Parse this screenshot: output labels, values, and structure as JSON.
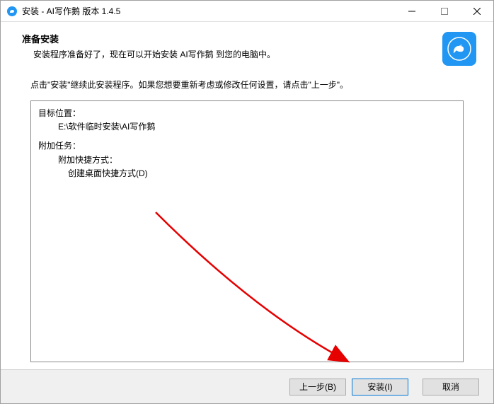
{
  "titlebar": {
    "title": "安装 - AI写作鹅 版本 1.4.5"
  },
  "header": {
    "title": "准备安装",
    "subtitle": "安装程序准备好了，现在可以开始安装 AI写作鹅 到您的电脑中。"
  },
  "instruction": "点击\"安装\"继续此安装程序。如果您想要重新考虑或修改任何设置，请点击\"上一步\"。",
  "summary": {
    "dest_label": "目标位置：",
    "dest_path": "E:\\软件临时安装\\AI写作鹅",
    "tasks_label": "附加任务：",
    "shortcuts_label": "附加快捷方式：",
    "desktop_shortcut": "创建桌面快捷方式(D)"
  },
  "buttons": {
    "back": "上一步(B)",
    "install": "安装(I)",
    "cancel": "取消"
  }
}
